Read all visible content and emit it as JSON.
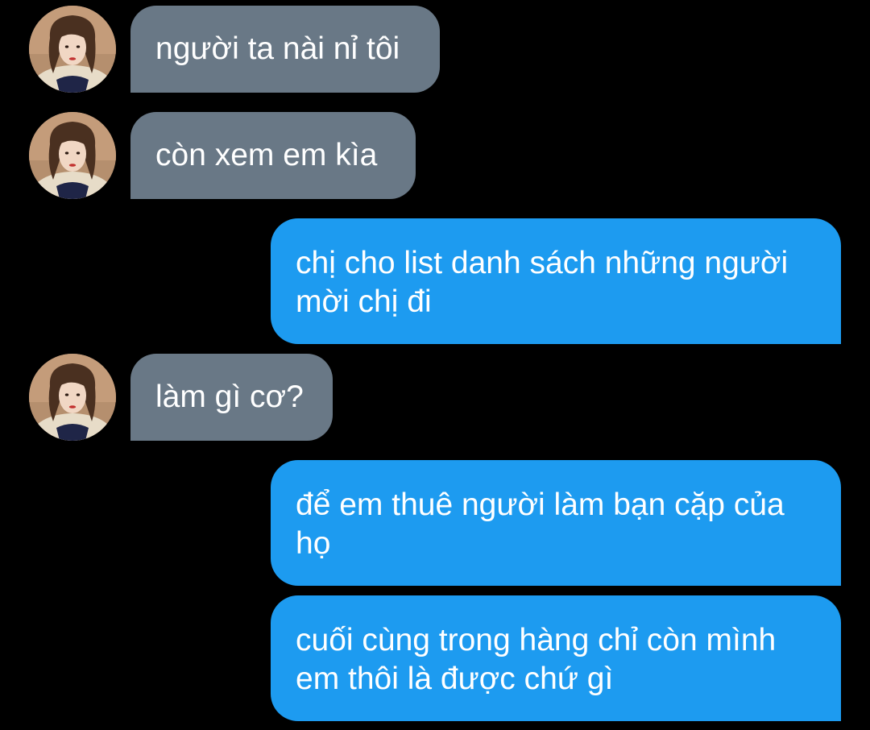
{
  "contact": {
    "avatar_icon": "profile-photo-avatar"
  },
  "colors": {
    "background": "#000000",
    "incoming_bubble": "#697886",
    "outgoing_bubble": "#1d9bf0",
    "text": "#ffffff"
  },
  "messages": [
    {
      "direction": "incoming",
      "text": "người ta nài nỉ tôi"
    },
    {
      "direction": "incoming",
      "text": "còn xem em kìa"
    },
    {
      "direction": "outgoing",
      "text": "chị cho list danh sách những người mời chị đi"
    },
    {
      "direction": "incoming",
      "text": "làm gì cơ?"
    },
    {
      "direction": "outgoing",
      "text": "để em thuê người làm bạn cặp của họ"
    },
    {
      "direction": "outgoing",
      "text": "cuối cùng trong hàng chỉ còn mình em thôi là được chứ gì"
    }
  ]
}
